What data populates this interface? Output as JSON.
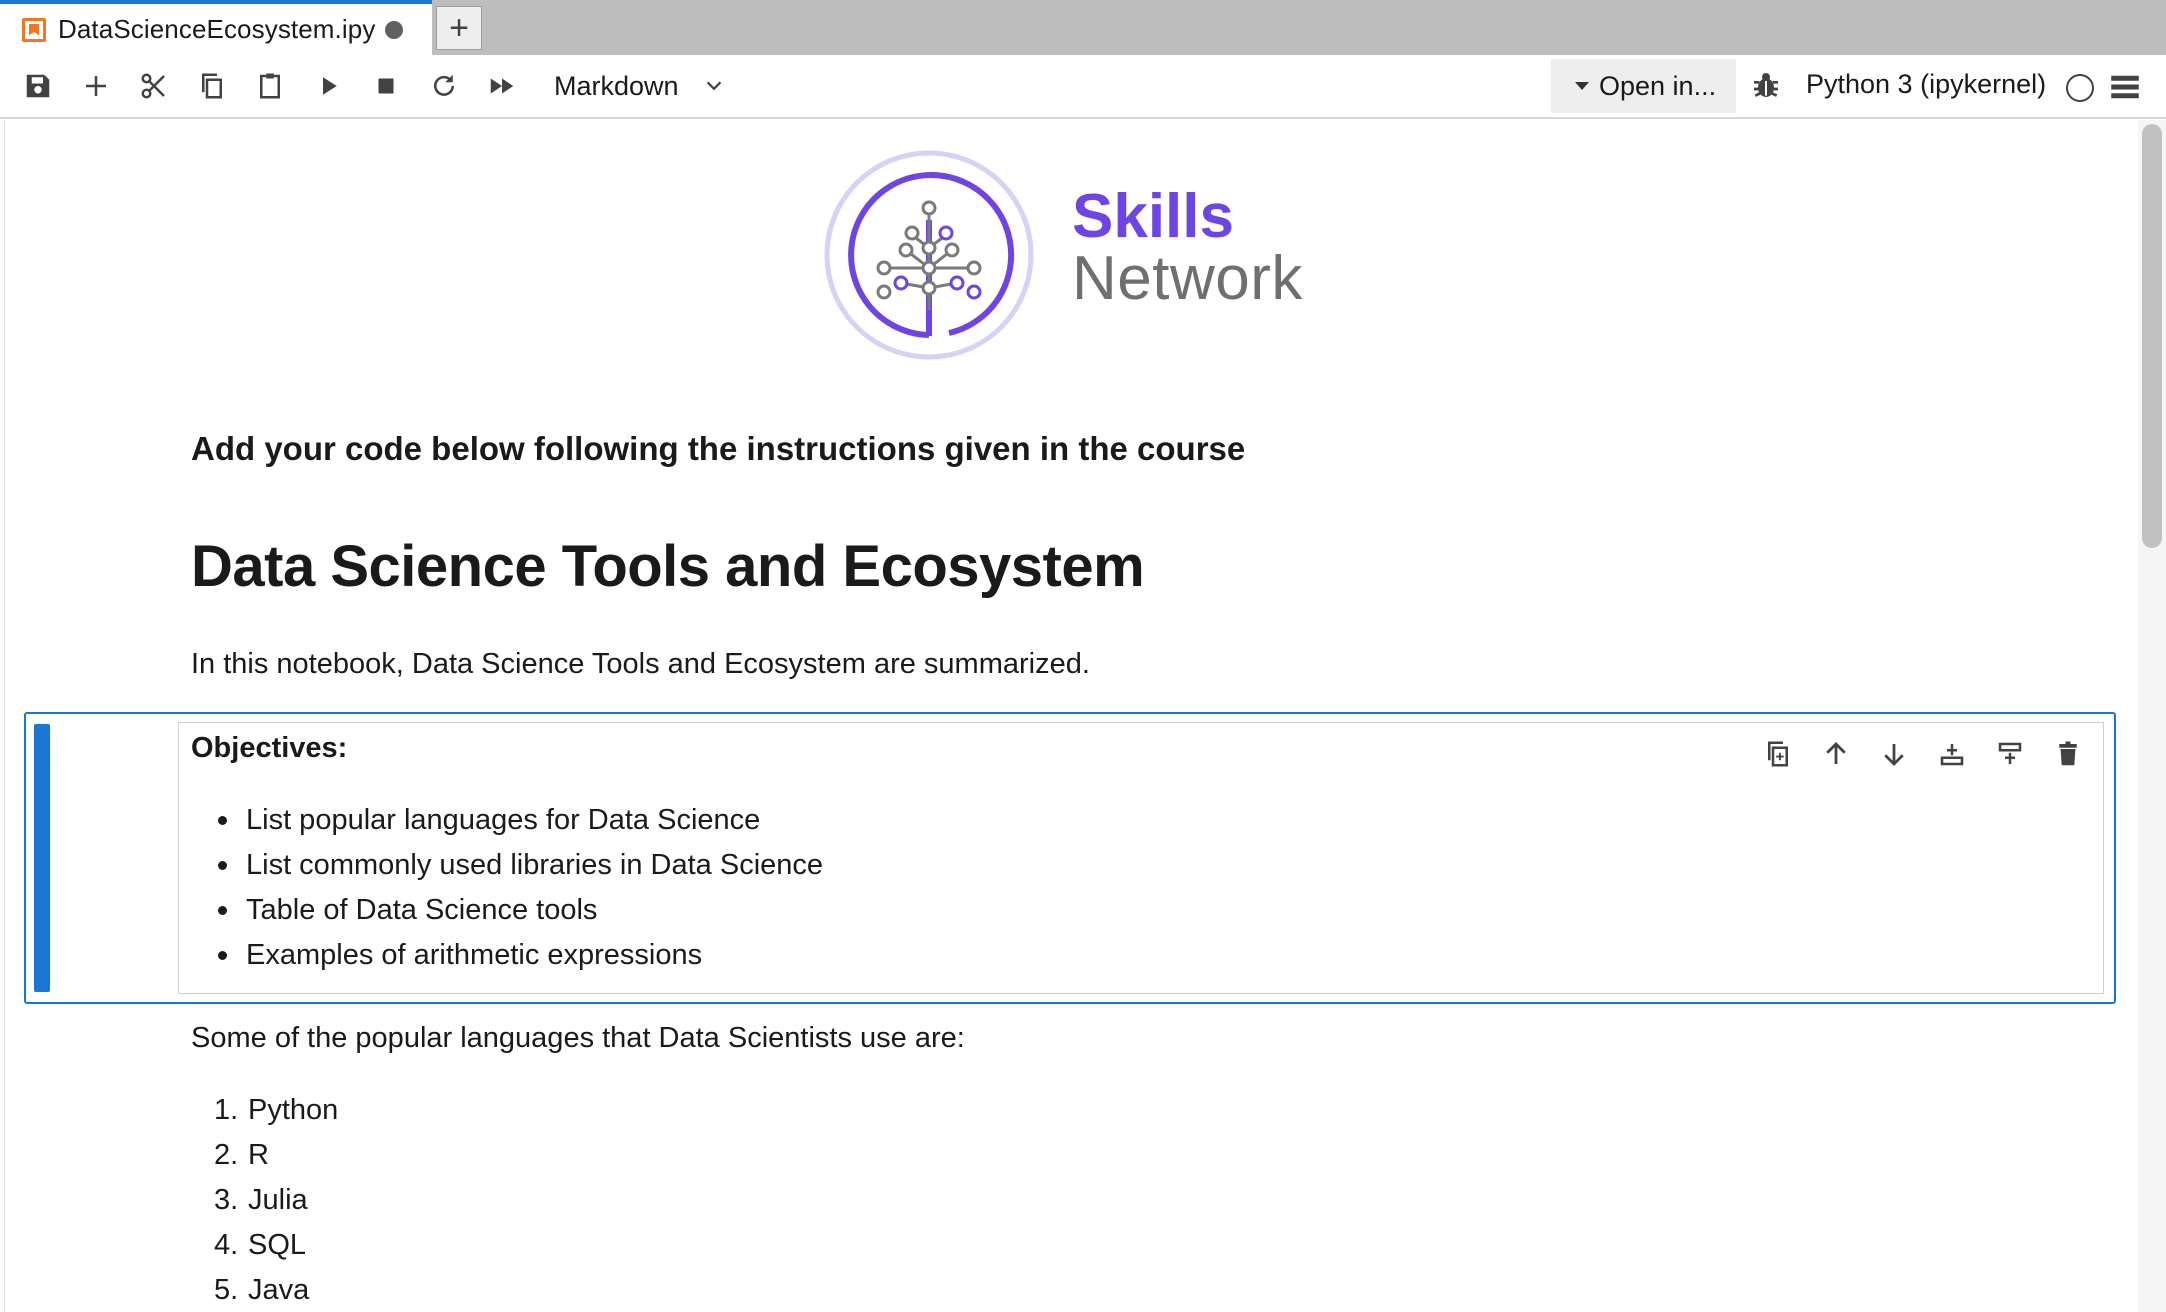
{
  "tab": {
    "title": "DataScienceEcosystem.ipy",
    "new_tab_label": "+"
  },
  "toolbar": {
    "buttons": [
      "save-icon",
      "add-cell-icon",
      "cut-icon",
      "copy-icon",
      "paste-icon",
      "run-icon",
      "stop-icon",
      "restart-icon",
      "run-all-icon"
    ],
    "cell_type": "Markdown",
    "open_in_label": "Open in...",
    "kernel_name": "Python 3 (ipykernel)"
  },
  "brand": {
    "line1": "Skills",
    "line2": "Network",
    "accent_color": "#6e45e2",
    "text_color": "#6f6f6f"
  },
  "notebook": {
    "instruction": "Add your code below following the instructions given in the course",
    "title": "Data Science Tools and Ecosystem",
    "intro": "In this notebook, Data Science Tools and Ecosystem are summarized.",
    "objectives_heading": "Objectives:",
    "objectives": [
      "List popular languages for Data Science",
      "List commonly used libraries in Data Science",
      "Table of Data Science tools",
      "Examples of arithmetic expressions"
    ],
    "languages_intro": "Some of the popular languages that Data Scientists use are:",
    "languages": [
      {
        "num": "1.",
        "name": "Python"
      },
      {
        "num": "2.",
        "name": "R"
      },
      {
        "num": "3.",
        "name": "Julia"
      },
      {
        "num": "4.",
        "name": "SQL"
      },
      {
        "num": "5.",
        "name": "Java"
      }
    ]
  },
  "cell_tools": [
    "duplicate-cell-icon",
    "move-up-icon",
    "move-down-icon",
    "insert-below-icon",
    "insert-above-icon",
    "delete-cell-icon"
  ],
  "colors": {
    "active_cell": "#1976d2",
    "tab_dirty": "#616161"
  }
}
